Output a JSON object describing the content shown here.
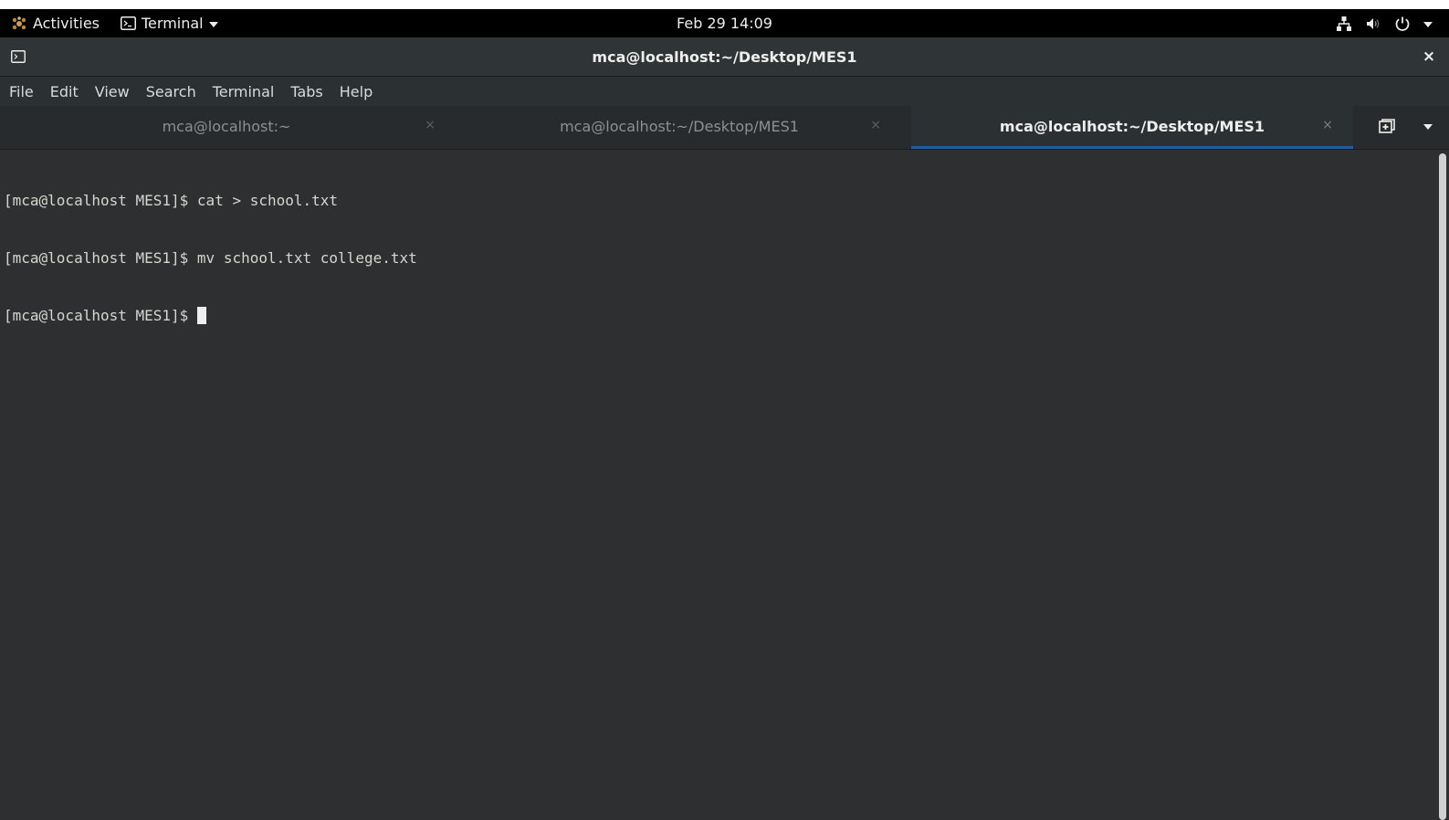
{
  "topbar": {
    "activities_label": "Activities",
    "app_menu_label": "Terminal",
    "clock": "Feb 29  14:09",
    "icons": [
      "activities-icon",
      "terminal-app-icon",
      "app-menu-arrow-icon",
      "network-icon",
      "volume-icon",
      "power-icon",
      "system-menu-arrow-icon"
    ]
  },
  "window": {
    "title": "mca@localhost:~/Desktop/MES1",
    "close_symbol": "×"
  },
  "menubar": {
    "items": [
      {
        "label": "File"
      },
      {
        "label": "Edit"
      },
      {
        "label": "View"
      },
      {
        "label": "Search"
      },
      {
        "label": "Terminal"
      },
      {
        "label": "Tabs"
      },
      {
        "label": "Help"
      }
    ]
  },
  "tabs": [
    {
      "label": "mca@localhost:~",
      "close": "×",
      "active": false
    },
    {
      "label": "mca@localhost:~/Desktop/MES1",
      "close": "×",
      "active": false
    },
    {
      "label": "mca@localhost:~/Desktop/MES1",
      "close": "×",
      "active": true
    }
  ],
  "terminal": {
    "lines": [
      "[mca@localhost MES1]$ cat > school.txt",
      "[mca@localhost MES1]$ mv school.txt college.txt",
      "[mca@localhost MES1]$ "
    ]
  },
  "colors": {
    "topbar_bg": "#000000",
    "headerbar_bg": "#2f3436",
    "terminal_bg": "#2d2f31",
    "terminal_fg": "#d3d7cf",
    "active_tab_accent": "#215d9c"
  }
}
